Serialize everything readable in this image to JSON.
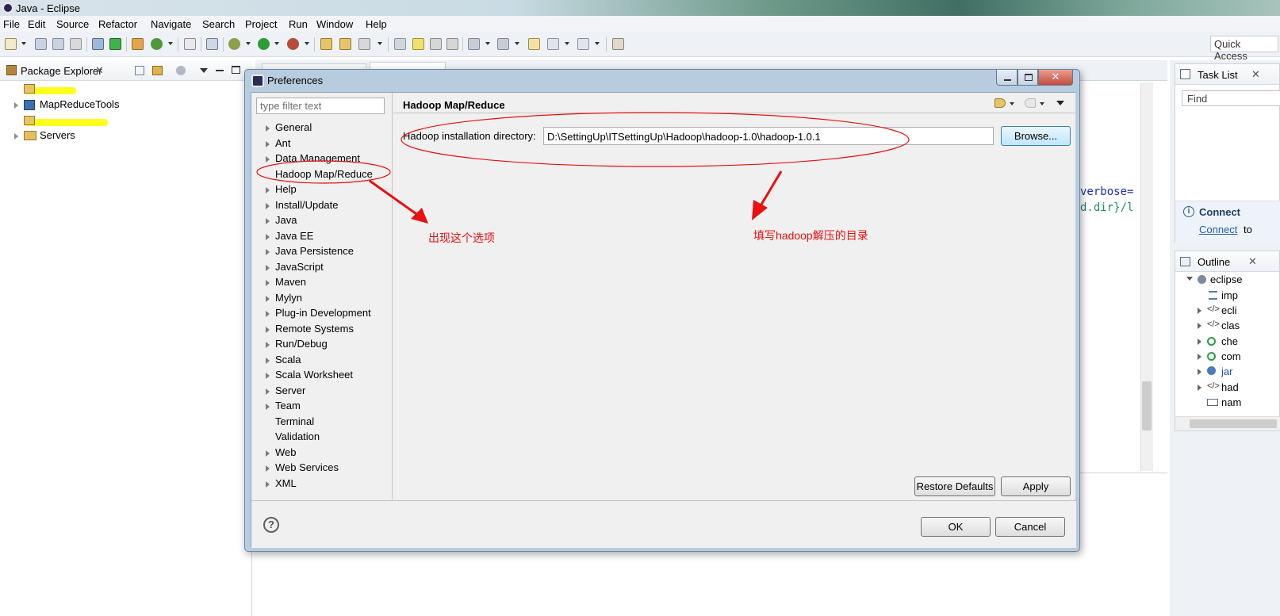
{
  "window": {
    "title": "Java - Eclipse"
  },
  "menu": [
    "File",
    "Edit",
    "Source",
    "Refactor",
    "Navigate",
    "Search",
    "Project",
    "Run",
    "Window",
    "Help"
  ],
  "quick_access": {
    "placeholder": "Quick Access"
  },
  "package_explorer": {
    "title": "Package Explorer",
    "items": [
      {
        "label": "MapReduceTools"
      },
      {
        "label": "Servers"
      }
    ]
  },
  "editor": {
    "code_lines": [
      "verbose=",
      "d.dir}/l"
    ]
  },
  "task_list": {
    "title": "Task List",
    "find_placeholder": "Find",
    "connect_heading": "Connect",
    "connect_link": "Connect",
    "connect_suffix": "to"
  },
  "outline": {
    "title": "Outline",
    "items": [
      "eclipse",
      "imp",
      "ecli",
      "clas",
      "che",
      "com",
      "jar",
      "had",
      "nam"
    ]
  },
  "dialog": {
    "title": "Preferences",
    "filter_placeholder": "type filter text",
    "nav_items": [
      {
        "label": "General",
        "expandable": true
      },
      {
        "label": "Ant",
        "expandable": true
      },
      {
        "label": "Data Management",
        "expandable": true
      },
      {
        "label": "Hadoop Map/Reduce",
        "expandable": false,
        "selected": true
      },
      {
        "label": "Help",
        "expandable": true
      },
      {
        "label": "Install/Update",
        "expandable": true
      },
      {
        "label": "Java",
        "expandable": true
      },
      {
        "label": "Java EE",
        "expandable": true
      },
      {
        "label": "Java Persistence",
        "expandable": true
      },
      {
        "label": "JavaScript",
        "expandable": true
      },
      {
        "label": "Maven",
        "expandable": true
      },
      {
        "label": "Mylyn",
        "expandable": true
      },
      {
        "label": "Plug-in Development",
        "expandable": true
      },
      {
        "label": "Remote Systems",
        "expandable": true
      },
      {
        "label": "Run/Debug",
        "expandable": true
      },
      {
        "label": "Scala",
        "expandable": true
      },
      {
        "label": "Scala Worksheet",
        "expandable": true
      },
      {
        "label": "Server",
        "expandable": true
      },
      {
        "label": "Team",
        "expandable": true
      },
      {
        "label": "Terminal",
        "expandable": false
      },
      {
        "label": "Validation",
        "expandable": false
      },
      {
        "label": "Web",
        "expandable": true
      },
      {
        "label": "Web Services",
        "expandable": true
      },
      {
        "label": "XML",
        "expandable": true
      }
    ],
    "page": {
      "title": "Hadoop Map/Reduce",
      "dir_label": "Hadoop installation directory:",
      "dir_value": "D:\\SettingUp\\ITSettingUp\\Hadoop\\hadoop-1.0\\hadoop-1.0.1",
      "browse": "Browse...",
      "restore_defaults": "Restore Defaults",
      "apply": "Apply"
    },
    "ok": "OK",
    "cancel": "Cancel"
  },
  "annotations": {
    "option_note": "出现这个选项",
    "dir_note": "填写hadoop解压的目录"
  },
  "colors": {
    "annotation_red": "#e81010",
    "highlighter_yellow": "#ffff1e",
    "dialog_frame": "#b8ccdf",
    "code_blue": "#1e2cb2",
    "close_button_red": "#c94a3f"
  }
}
